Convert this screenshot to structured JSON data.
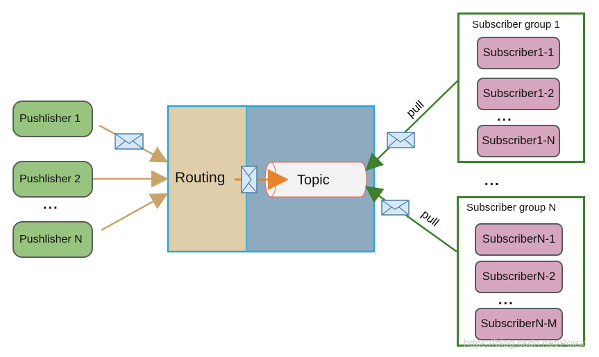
{
  "publishers": [
    {
      "label": "Pushlisher 1"
    },
    {
      "label": "Pushlisher 2"
    },
    {
      "label": "Pushlisher N"
    }
  ],
  "ellipsis": "...",
  "broker": {
    "routing_label": "Routing",
    "topic_label": "Topic"
  },
  "edge_labels": {
    "pull_1": "pull",
    "pull_n": "pull"
  },
  "subscriber_groups": [
    {
      "title": "Subscriber group 1",
      "members": [
        "Subscriber1-1",
        "Subscriber1-2",
        "Subscriber1-N"
      ]
    },
    {
      "title": "Subscriber group N",
      "members": [
        "SubscriberN-1",
        "SubscriberN-2",
        "SubscriberN-M"
      ]
    }
  ],
  "watermark": "https://blog.csdn.net/Poisx",
  "colors": {
    "publisher": "#97c47e",
    "subscriber": "#d5a6bd",
    "routing": "#e0cdaa",
    "broker": "#8eaabf",
    "broker_border": "#2aa7d8",
    "push_arrow": "#c9a46a",
    "pull_line": "#3f7f2e",
    "internal_arrow": "#e8842c"
  }
}
